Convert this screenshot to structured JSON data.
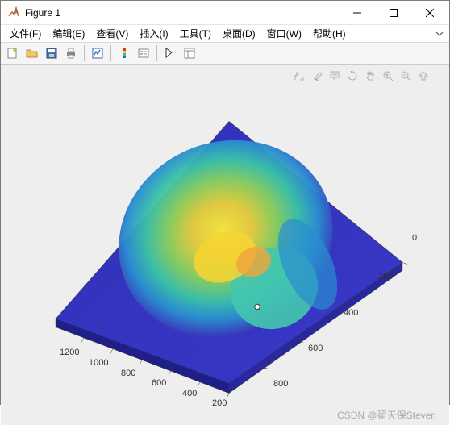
{
  "window": {
    "title": "Figure 1"
  },
  "menu": {
    "file": "文件(F)",
    "edit": "编辑(E)",
    "view": "查看(V)",
    "insert": "插入(I)",
    "tools": "工具(T)",
    "desktop": "桌面(D)",
    "window": "窗口(W)",
    "help": "帮助(H)"
  },
  "chart_data": {
    "type": "heatmap",
    "description": "3D surface / image rendering (head X-ray colormap)",
    "colormap": "parula",
    "x_ticks": [
      200,
      400,
      600,
      800,
      1000,
      1200
    ],
    "y_ticks": [
      0,
      200,
      400,
      600,
      800
    ],
    "xlim": [
      0,
      1200
    ],
    "ylim": [
      0,
      800
    ],
    "view": "3d-perspective"
  },
  "watermark": {
    "prefix": "CSDN @",
    "author": "翟天保Steven"
  }
}
